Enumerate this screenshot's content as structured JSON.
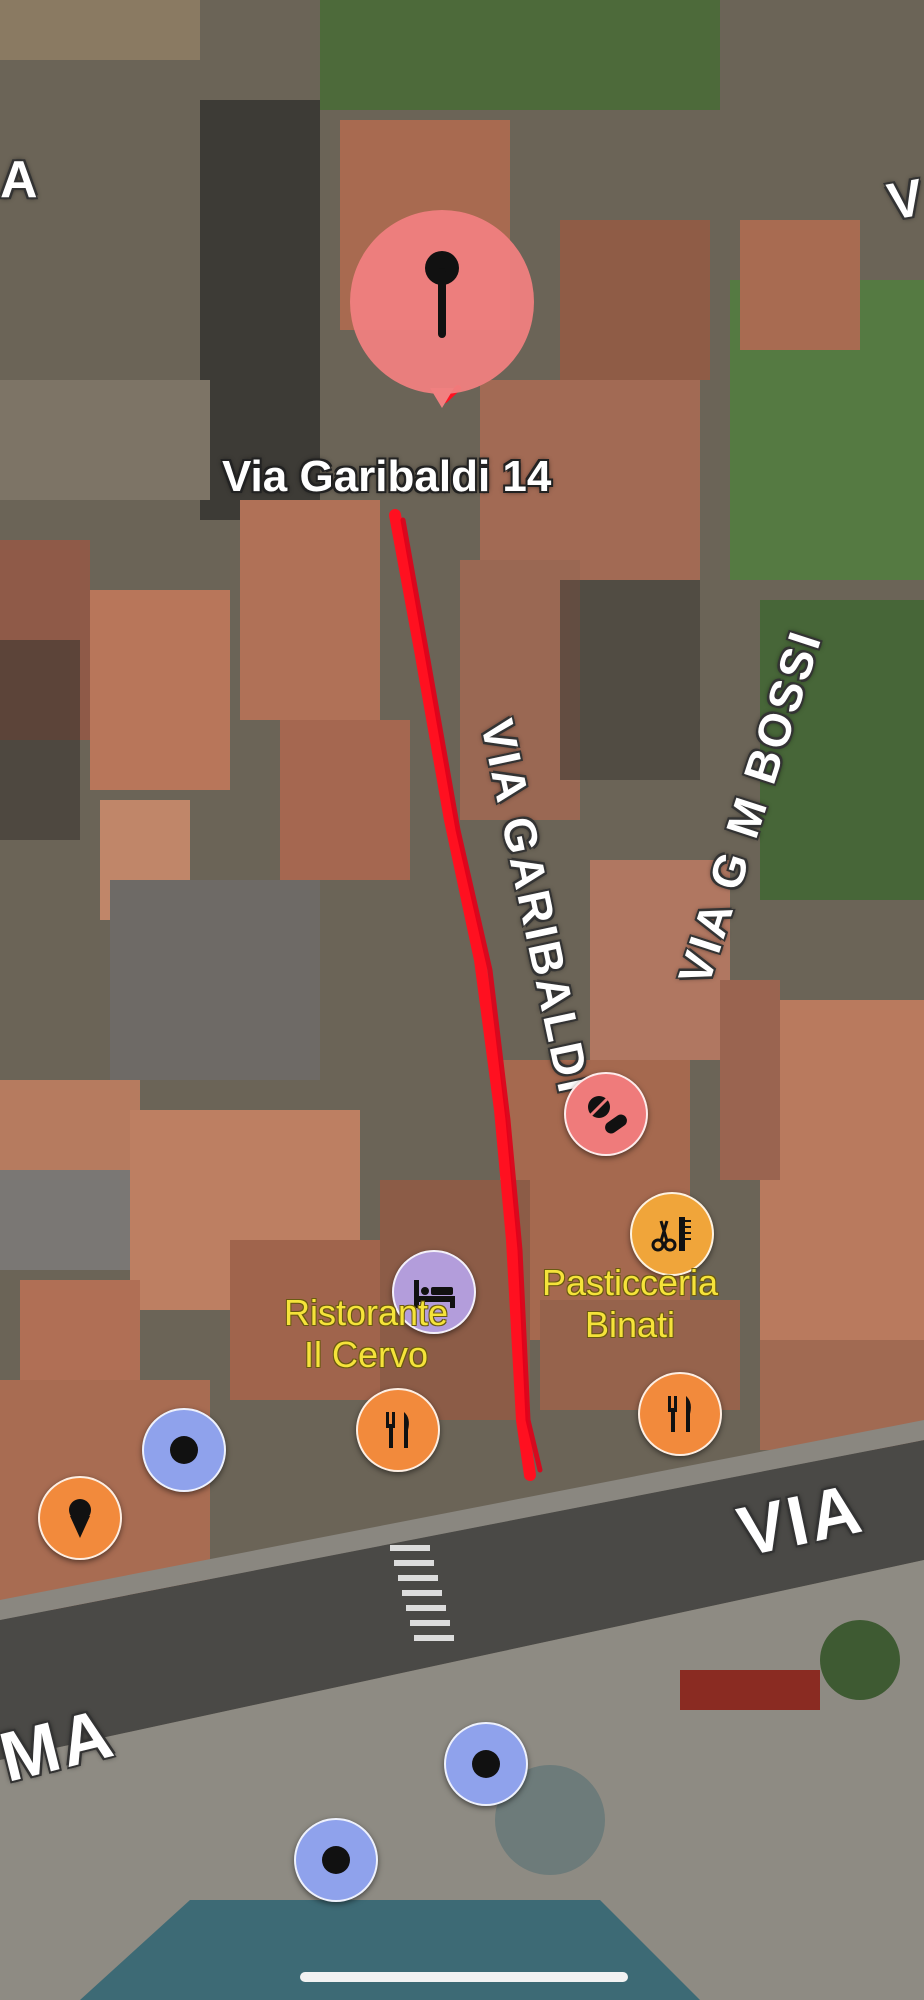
{
  "pin": {
    "label": "Via Garibaldi 14",
    "color": "#f08080",
    "icon": "map-pin-icon"
  },
  "streets": {
    "via_garibaldi": "VIA GARIBALDI",
    "via_bossi": "VIA G M BOSSI",
    "via_bottom": "VIA",
    "via_left_fragment": "MA",
    "via_top_right_fragment": "V",
    "top_left_fragment": "A"
  },
  "pois": {
    "ristorante": {
      "name_line1": "Ristorante",
      "name_line2": "Il Cervo",
      "icon": "fork-knife-icon"
    },
    "pasticceria": {
      "name_line1": "Pasticceria",
      "name_line2": "Binati",
      "icon": "fork-knife-icon"
    },
    "pharmacy": {
      "icon": "pill-icon"
    },
    "hotel": {
      "icon": "bed-icon"
    },
    "hair_salon": {
      "icon": "scissors-comb-icon"
    },
    "ice_cream": {
      "icon": "ice-cream-icon"
    },
    "transit": {
      "icon": "transit-dot-icon"
    }
  },
  "colors": {
    "food": "#f28a3c",
    "pharmacy": "#ef7b7b",
    "hotel": "#b39ddb",
    "salon": "#f0a53a",
    "transit": "#8fa2ec",
    "route": "#ff1020",
    "poi_text": "#f5e33a"
  }
}
